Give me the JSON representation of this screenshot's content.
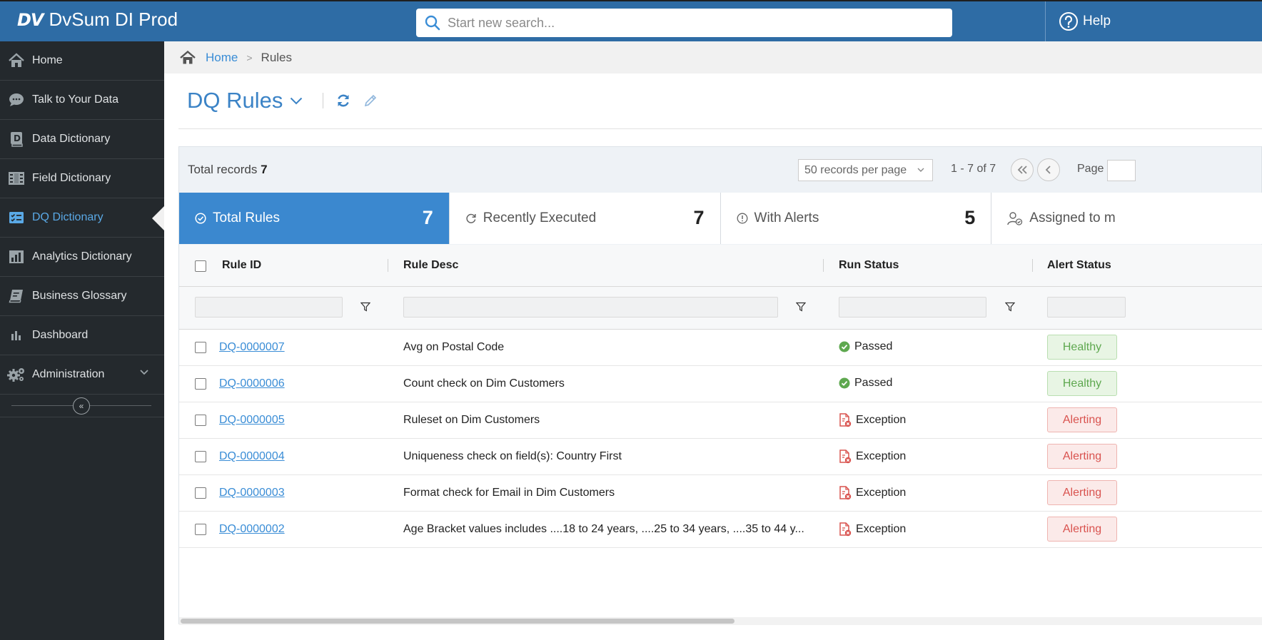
{
  "app": {
    "logo_mark": "DV",
    "name": "DvSum DI Prod"
  },
  "search": {
    "placeholder": "Start new search..."
  },
  "help": {
    "label": "Help"
  },
  "sidebar": {
    "items": [
      {
        "label": "Home",
        "icon": "home-icon"
      },
      {
        "label": "Talk to Your Data",
        "icon": "chat-icon"
      },
      {
        "label": "Data Dictionary",
        "icon": "data-dictionary-icon"
      },
      {
        "label": "Field Dictionary",
        "icon": "field-dictionary-icon"
      },
      {
        "label": "DQ Dictionary",
        "icon": "dq-dictionary-icon",
        "active": true
      },
      {
        "label": "Analytics Dictionary",
        "icon": "bar-chart-icon"
      },
      {
        "label": "Business Glossary",
        "icon": "book-icon"
      },
      {
        "label": "Dashboard",
        "icon": "dashboard-icon"
      },
      {
        "label": "Administration",
        "icon": "gears-icon"
      }
    ],
    "collapse_glyph": "«"
  },
  "breadcrumb": {
    "home": "Home",
    "separator": ">",
    "current": "Rules"
  },
  "page": {
    "title": "DQ Rules"
  },
  "toolbar": {
    "total_records_label": "Total records",
    "total_records_value": "7",
    "per_page": "50 records per page",
    "range": "1 - 7 of 7",
    "page_label": "Page"
  },
  "cards": [
    {
      "label": "Total Rules",
      "count": "7",
      "icon": "check-circle-icon"
    },
    {
      "label": "Recently Executed",
      "count": "7",
      "icon": "refresh-icon"
    },
    {
      "label": "With Alerts",
      "count": "5",
      "icon": "info-circle-icon"
    },
    {
      "label": "Assigned to m",
      "count": "",
      "icon": "user-check-icon"
    }
  ],
  "table": {
    "columns": [
      "Rule ID",
      "Rule Desc",
      "Run Status",
      "Alert Status"
    ],
    "rows": [
      {
        "id": "DQ-0000007",
        "desc": "Avg on Postal Code",
        "run": "Passed",
        "alert": "Healthy"
      },
      {
        "id": "DQ-0000006",
        "desc": "Count check on Dim Customers",
        "run": "Passed",
        "alert": "Healthy"
      },
      {
        "id": "DQ-0000005",
        "desc": "Ruleset on Dim Customers",
        "run": "Exception",
        "alert": "Alerting"
      },
      {
        "id": "DQ-0000004",
        "desc": "Uniqueness check on field(s): Country First",
        "run": "Exception",
        "alert": "Alerting"
      },
      {
        "id": "DQ-0000003",
        "desc": "Format check for Email in Dim Customers",
        "run": "Exception",
        "alert": "Alerting"
      },
      {
        "id": "DQ-0000002",
        "desc": "Age Bracket values includes ....18 to 24 years, ....25 to 34 years, ....35 to 44 y...",
        "run": "Exception",
        "alert": "Alerting"
      }
    ]
  },
  "colors": {
    "topbar": "#2e6ca5",
    "sidebar": "#24292d",
    "accent": "#3b88cf",
    "passed": "#5ea84f",
    "exception": "#d9534f"
  }
}
